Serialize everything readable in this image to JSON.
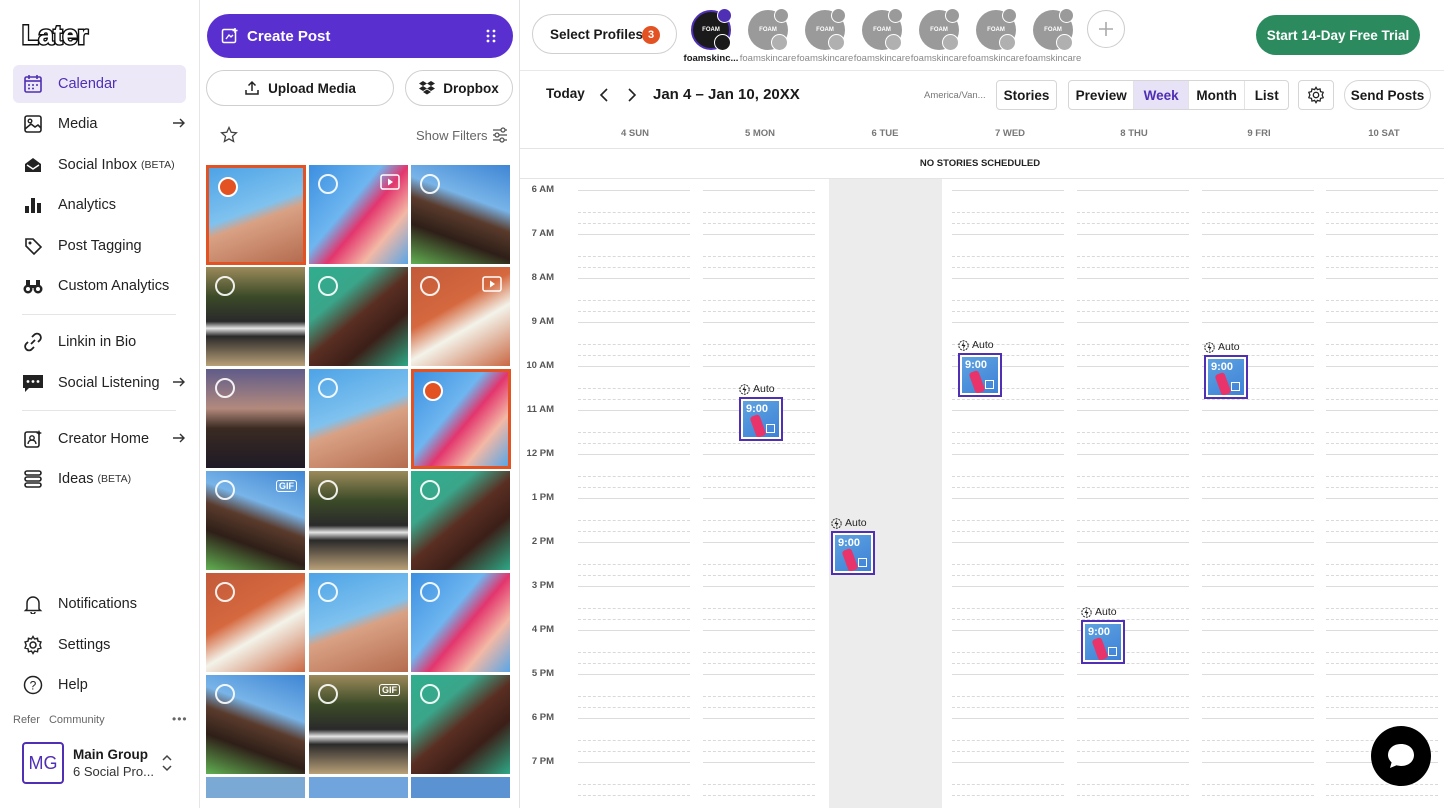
{
  "sidebar": {
    "brand": "Later",
    "items": [
      {
        "label": "Calendar",
        "icon": "calendar-icon"
      },
      {
        "label": "Media",
        "icon": "image-icon"
      },
      {
        "label": "Social Inbox",
        "beta": "(BETA)",
        "icon": "inbox-icon"
      },
      {
        "label": "Analytics",
        "icon": "bar-chart-icon"
      },
      {
        "label": "Post Tagging",
        "icon": "tag-icon"
      },
      {
        "label": "Custom Analytics",
        "icon": "binoculars-icon"
      },
      {
        "label": "Linkin in Bio",
        "icon": "link-icon"
      },
      {
        "label": "Social Listening",
        "icon": "chat-dots-icon"
      },
      {
        "label": "Creator Home",
        "icon": "creator-icon"
      },
      {
        "label": "Ideas",
        "beta": "(BETA)",
        "icon": "ideas-icon"
      },
      {
        "label": "Notifications",
        "icon": "bell-icon"
      },
      {
        "label": "Settings",
        "icon": "gear-icon"
      },
      {
        "label": "Help",
        "icon": "help-icon"
      }
    ],
    "refer": "Refer",
    "community": "Community",
    "group": {
      "initials": "MG",
      "name": "Main Group",
      "sub": "6 Social Pro..."
    }
  },
  "media": {
    "create_post": "Create Post",
    "upload": "Upload Media",
    "dropbox": "Dropbox",
    "show_filters": "Show Filters",
    "badges": {
      "gif": "GIF"
    }
  },
  "topbar": {
    "select_profiles": "Select Profiles",
    "selected_count": "3",
    "profiles": [
      {
        "name": "foamskinc...",
        "network": "instagram"
      },
      {
        "name": "foamskincare",
        "network": "facebook"
      },
      {
        "name": "foamskincare",
        "network": "twitter"
      },
      {
        "name": "foamskincare",
        "network": "pinterest"
      },
      {
        "name": "foamskincare",
        "network": "tiktok"
      },
      {
        "name": "foamskincare",
        "network": "linkedin"
      },
      {
        "name": "foamskincare",
        "network": "youtube"
      }
    ],
    "avatar_text": "FOAM",
    "trial": "Start 14-Day Free Trial"
  },
  "toolbar": {
    "today": "Today",
    "range": "Jan 4 – Jan 10, 20XX",
    "timezone": "America/Van...",
    "stories": "Stories",
    "views": [
      "Preview",
      "Week",
      "Month",
      "List"
    ],
    "active_view": "Week",
    "send_posts": "Send Posts"
  },
  "calendar": {
    "days": [
      "4 SUN",
      "5 MON",
      "6 TUE",
      "7 WED",
      "8 THU",
      "9 FRI",
      "10 SAT"
    ],
    "no_stories": "NO STORIES SCHEDULED",
    "hours": [
      "6 AM",
      "7 AM",
      "8 AM",
      "9 AM",
      "10 AM",
      "11 AM",
      "12 PM",
      "1 PM",
      "2 PM",
      "3 PM",
      "4 PM",
      "5 PM",
      "6 PM",
      "7 PM"
    ],
    "auto_label": "Auto",
    "post_time": "9:00"
  },
  "colors": {
    "brand": "#5a2fcf",
    "accent_orange": "#e35222",
    "trial_green": "#2b8a5e"
  }
}
